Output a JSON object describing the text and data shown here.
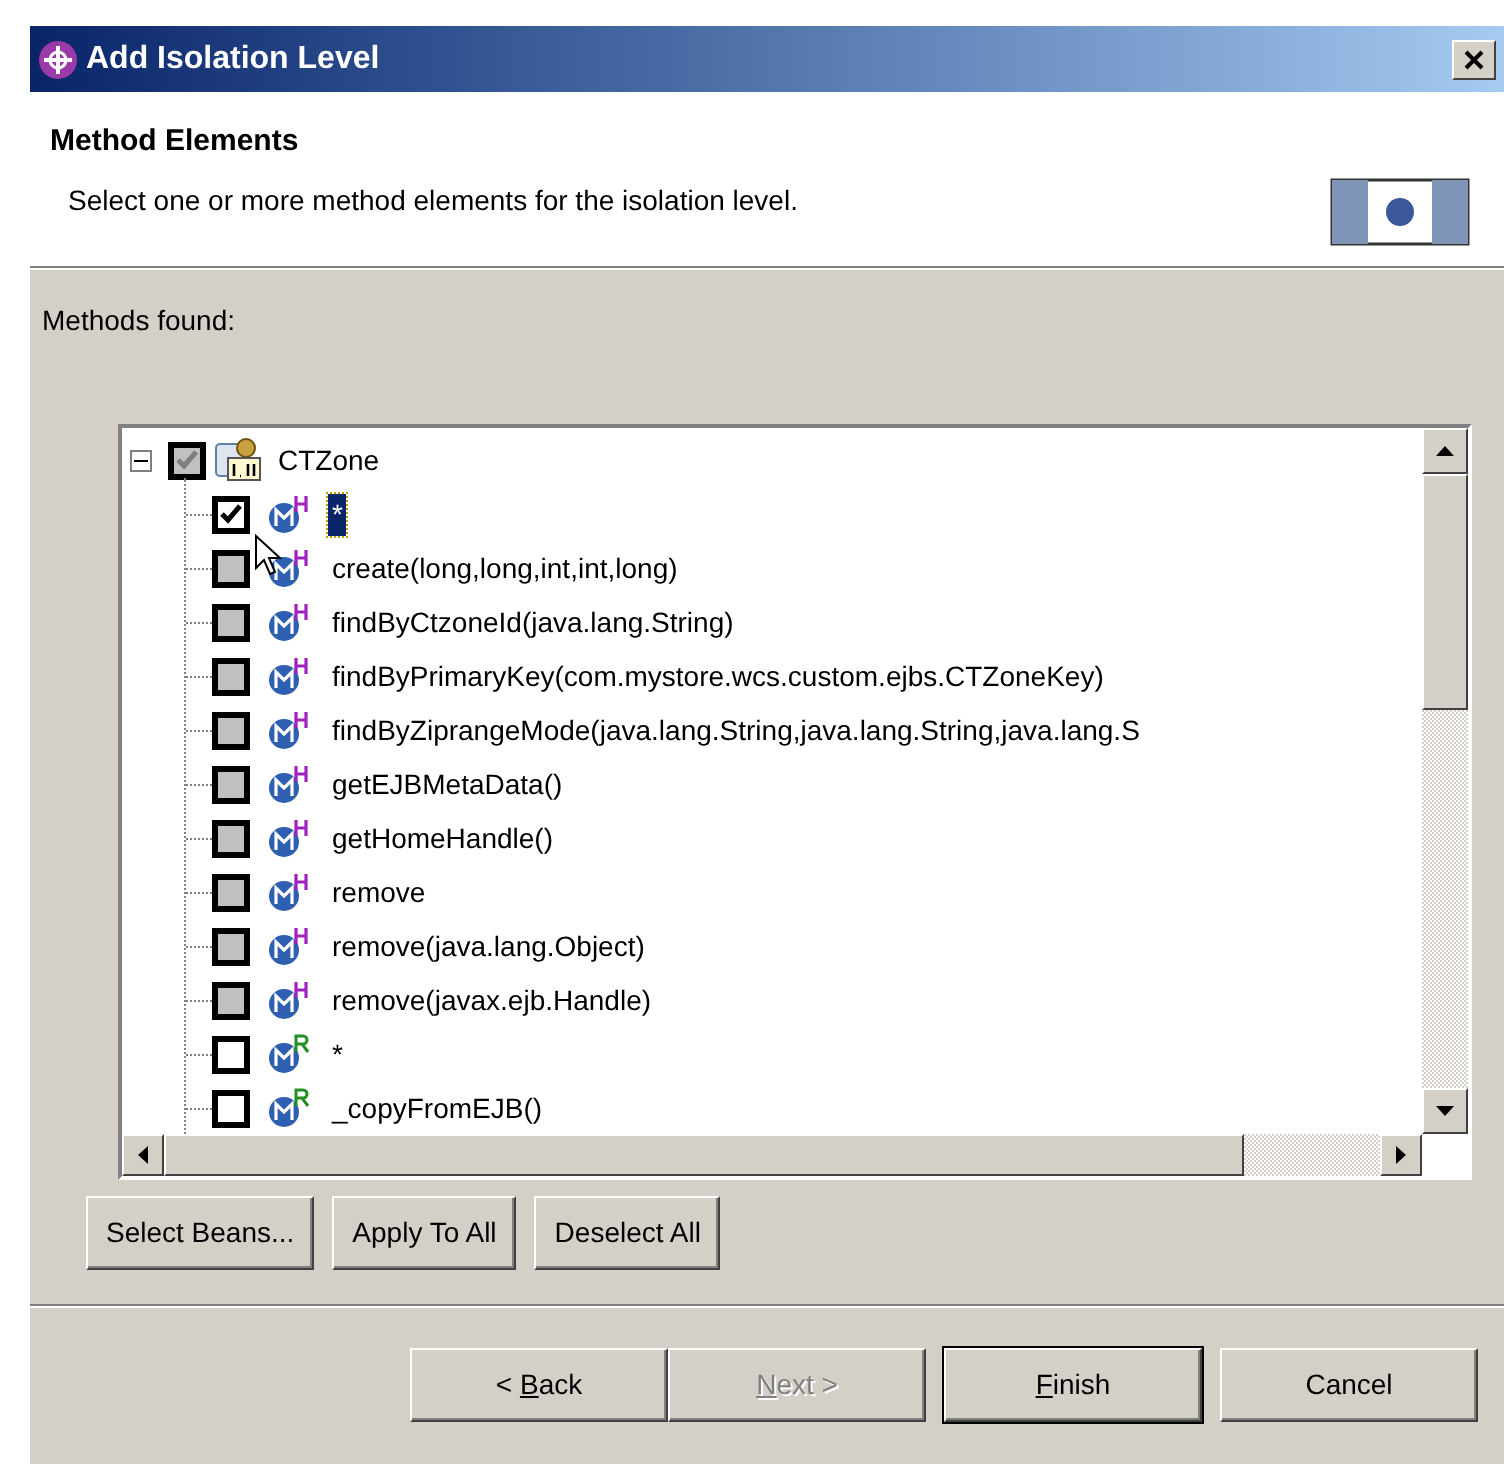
{
  "window": {
    "title": "Add Isolation Level"
  },
  "header": {
    "title": "Method Elements",
    "description": "Select one or more method elements for the isolation level."
  },
  "tree_label": "Methods found:",
  "tree": {
    "label": "CTZone",
    "expanded": true,
    "checked": true,
    "grayed": true,
    "children": [
      {
        "label": "*",
        "kind": "home",
        "checked": true,
        "grayed": false,
        "selected": true
      },
      {
        "label": "create(long,long,int,int,long)",
        "kind": "home",
        "checked": false,
        "grayed": true,
        "selected": false
      },
      {
        "label": "findByCtzoneId(java.lang.String)",
        "kind": "home",
        "checked": false,
        "grayed": true,
        "selected": false
      },
      {
        "label": "findByPrimaryKey(com.mystore.wcs.custom.ejbs.CTZoneKey)",
        "kind": "home",
        "checked": false,
        "grayed": true,
        "selected": false
      },
      {
        "label": "findByZiprangeMode(java.lang.String,java.lang.String,java.lang.S",
        "kind": "home",
        "checked": false,
        "grayed": true,
        "selected": false
      },
      {
        "label": "getEJBMetaData()",
        "kind": "home",
        "checked": false,
        "grayed": true,
        "selected": false
      },
      {
        "label": "getHomeHandle()",
        "kind": "home",
        "checked": false,
        "grayed": true,
        "selected": false
      },
      {
        "label": "remove",
        "kind": "home",
        "checked": false,
        "grayed": true,
        "selected": false
      },
      {
        "label": "remove(java.lang.Object)",
        "kind": "home",
        "checked": false,
        "grayed": true,
        "selected": false
      },
      {
        "label": "remove(javax.ejb.Handle)",
        "kind": "home",
        "checked": false,
        "grayed": true,
        "selected": false
      },
      {
        "label": "*",
        "kind": "remote",
        "checked": false,
        "grayed": false,
        "selected": false
      },
      {
        "label": "_copyFromEJB()",
        "kind": "remote",
        "checked": false,
        "grayed": false,
        "selected": false
      }
    ]
  },
  "tree_buttons": [
    "Select Beans...",
    "Apply To All",
    "Deselect All"
  ],
  "nav_buttons": [
    {
      "before": "< ",
      "key": "B",
      "after": "ack",
      "disabled": false,
      "default": false
    },
    {
      "key": "N",
      "after": "ext >",
      "disabled": true,
      "default": false
    },
    {
      "key": "F",
      "after": "inish",
      "disabled": false,
      "default": true
    },
    {
      "before": "Cancel",
      "disabled": false,
      "default": false
    }
  ]
}
